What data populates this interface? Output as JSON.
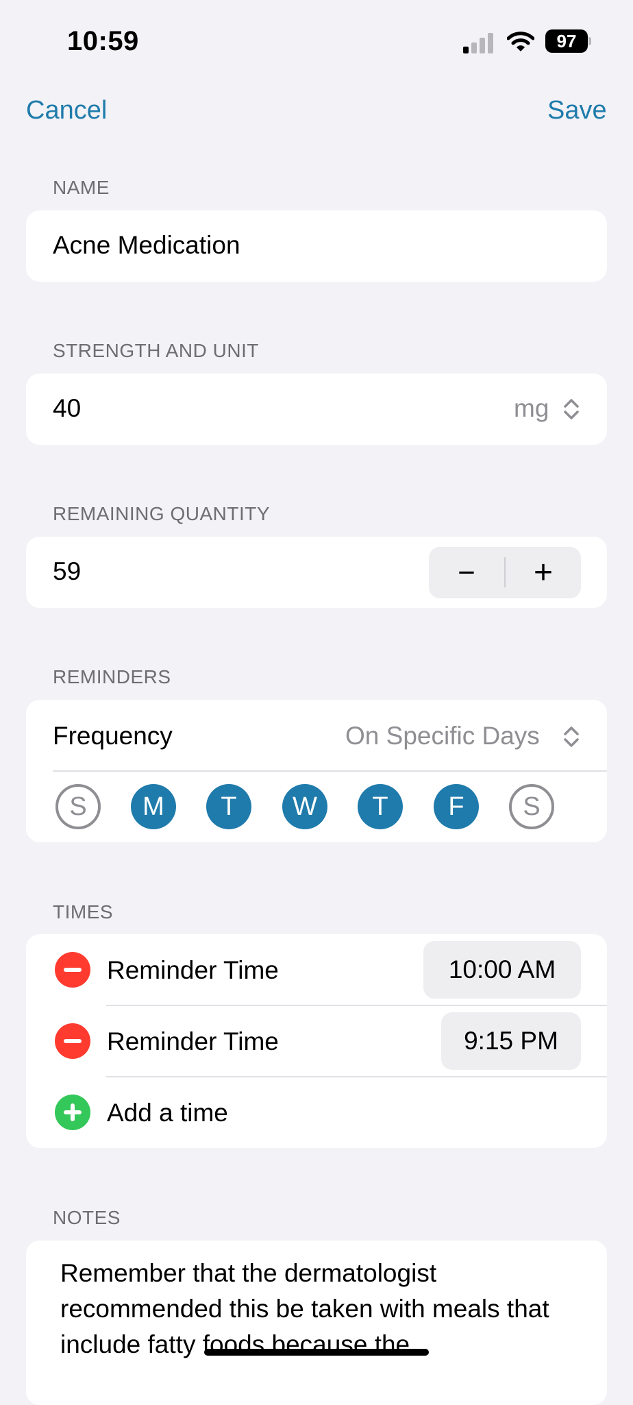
{
  "status_bar": {
    "time": "10:59",
    "battery": "97"
  },
  "nav": {
    "cancel": "Cancel",
    "save": "Save"
  },
  "name_section": {
    "label": "NAME",
    "value": "Acne Medication"
  },
  "strength_section": {
    "label": "STRENGTH AND UNIT",
    "value": "40",
    "unit": "mg"
  },
  "quantity_section": {
    "label": "REMAINING QUANTITY",
    "value": "59",
    "minus": "−",
    "plus": "+"
  },
  "reminders_section": {
    "label": "REMINDERS",
    "frequency_label": "Frequency",
    "frequency_value": "On Specific Days",
    "days": [
      {
        "letter": "S",
        "selected": false
      },
      {
        "letter": "M",
        "selected": true
      },
      {
        "letter": "T",
        "selected": true
      },
      {
        "letter": "W",
        "selected": true
      },
      {
        "letter": "T",
        "selected": true
      },
      {
        "letter": "F",
        "selected": true
      },
      {
        "letter": "S",
        "selected": false
      }
    ]
  },
  "times_section": {
    "label": "TIMES",
    "rows": [
      {
        "label": "Reminder Time",
        "time": "10:00 AM"
      },
      {
        "label": "Reminder Time",
        "time": "9:15 PM"
      }
    ],
    "add_label": "Add a time"
  },
  "notes_section": {
    "label": "NOTES",
    "text": "Remember that the dermatologist recommended this be taken with meals that include fatty foods because the"
  },
  "colors": {
    "accent": "#1f7bab",
    "remove": "#ff3b30",
    "add": "#34c759",
    "background": "#f2f2f7"
  }
}
